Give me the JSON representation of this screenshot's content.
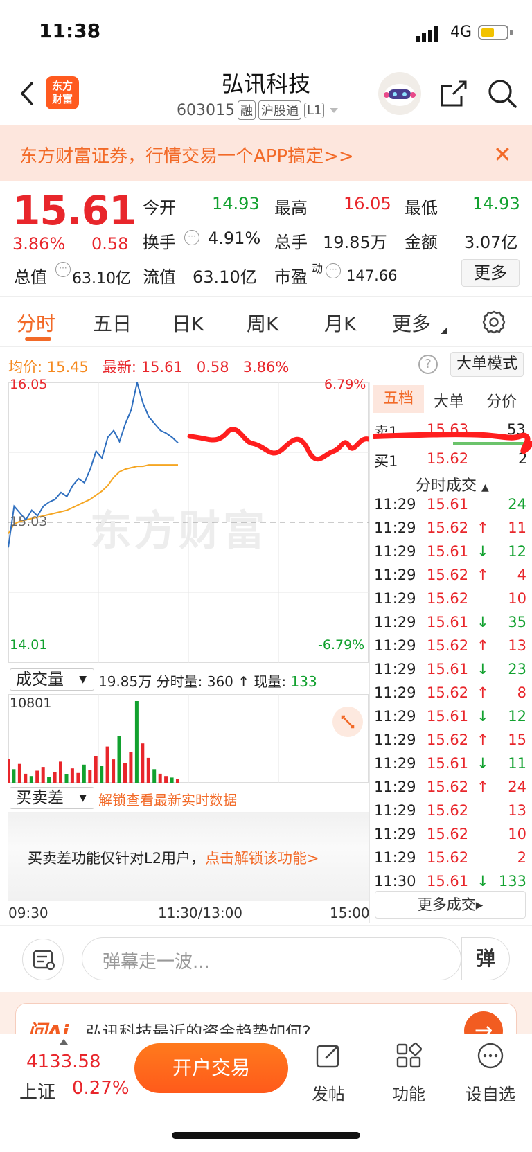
{
  "status_bar": {
    "time": "11:38",
    "network": "4G"
  },
  "header": {
    "app_logo_line1": "东方",
    "app_logo_line2": "财富",
    "stock_name": "弘讯科技",
    "stock_code": "603015",
    "tags": [
      "融",
      "沪股通",
      "L1"
    ]
  },
  "banner": {
    "text": "东方财富证券，行情交易一个APP搞定>>"
  },
  "quote": {
    "last_price": "15.61",
    "change_pct": "3.86%",
    "change_amt": "0.58",
    "fields": [
      {
        "label": "今开",
        "value": "14.93",
        "color": "#12a12f"
      },
      {
        "label": "最高",
        "value": "16.05",
        "color": "#e8262b"
      },
      {
        "label": "最低",
        "value": "14.93",
        "color": "#12a12f"
      },
      {
        "label": "换手",
        "value": "4.91%",
        "color": "#222222"
      },
      {
        "label": "总手",
        "value": "19.85万",
        "color": "#222222"
      },
      {
        "label": "金额",
        "value": "3.07亿",
        "color": "#222222"
      },
      {
        "label": "总值",
        "value": "63.10亿",
        "color": "#222222"
      },
      {
        "label": "流值",
        "value": "63.10亿",
        "color": "#222222"
      },
      {
        "label": "市盈",
        "sup": "动",
        "value": "147.66",
        "color": "#222222"
      }
    ],
    "more_label": "更多"
  },
  "tabs": [
    "分时",
    "五日",
    "日K",
    "周K",
    "月K",
    "更多"
  ],
  "avg_row": {
    "avg_label": "均价:",
    "avg_value": "15.45",
    "latest_label": "最新:",
    "latest_value": "15.61",
    "chg": "0.58",
    "pct": "3.86%",
    "big_order_label": "大单模式"
  },
  "chart_labels": {
    "y_top": "16.05",
    "y_bottom": "14.01",
    "pct_top": "6.79%",
    "pct_bottom": "-6.79%",
    "y_mid": "15.03",
    "watermark": "东方财富"
  },
  "volume": {
    "select_label": "成交量",
    "total": "19.85万",
    "period_label": "分时量:",
    "period_value": "360",
    "now_label": "现量:",
    "now_value": "133",
    "max_label": "10801"
  },
  "diff": {
    "select_label": "买卖差",
    "info": "解锁查看最新实时数据",
    "panel_text": "买卖差功能仅针对L2用户，",
    "panel_link": "点击解锁该功能>"
  },
  "time_axis": [
    "09:30",
    "11:30/13:00",
    "15:00"
  ],
  "right_panel": {
    "tabs": [
      "五档",
      "大单",
      "分价"
    ],
    "sell1": {
      "label": "卖1",
      "price": "15.63",
      "vol": "53"
    },
    "buy1": {
      "label": "买1",
      "price": "15.62",
      "vol": "2"
    },
    "trades_title": "分时成交",
    "trades": [
      {
        "time": "11:29",
        "price": "15.61",
        "dir": "",
        "vol": "24",
        "vcolor": "#12a12f"
      },
      {
        "time": "11:29",
        "price": "15.62",
        "dir": "↑",
        "vol": "11",
        "vcolor": "#e8262b"
      },
      {
        "time": "11:29",
        "price": "15.61",
        "dir": "↓",
        "vol": "12",
        "vcolor": "#12a12f"
      },
      {
        "time": "11:29",
        "price": "15.62",
        "dir": "↑",
        "vol": "4",
        "vcolor": "#e8262b"
      },
      {
        "time": "11:29",
        "price": "15.62",
        "dir": "",
        "vol": "10",
        "vcolor": "#e8262b"
      },
      {
        "time": "11:29",
        "price": "15.61",
        "dir": "↓",
        "vol": "35",
        "vcolor": "#12a12f"
      },
      {
        "time": "11:29",
        "price": "15.62",
        "dir": "↑",
        "vol": "13",
        "vcolor": "#e8262b"
      },
      {
        "time": "11:29",
        "price": "15.61",
        "dir": "↓",
        "vol": "23",
        "vcolor": "#12a12f"
      },
      {
        "time": "11:29",
        "price": "15.62",
        "dir": "↑",
        "vol": "8",
        "vcolor": "#e8262b"
      },
      {
        "time": "11:29",
        "price": "15.61",
        "dir": "↓",
        "vol": "12",
        "vcolor": "#12a12f"
      },
      {
        "time": "11:29",
        "price": "15.62",
        "dir": "↑",
        "vol": "15",
        "vcolor": "#e8262b"
      },
      {
        "time": "11:29",
        "price": "15.61",
        "dir": "↓",
        "vol": "11",
        "vcolor": "#12a12f"
      },
      {
        "time": "11:29",
        "price": "15.62",
        "dir": "↑",
        "vol": "24",
        "vcolor": "#e8262b"
      },
      {
        "time": "11:29",
        "price": "15.62",
        "dir": "",
        "vol": "13",
        "vcolor": "#e8262b"
      },
      {
        "time": "11:29",
        "price": "15.62",
        "dir": "",
        "vol": "10",
        "vcolor": "#e8262b"
      },
      {
        "time": "11:29",
        "price": "15.62",
        "dir": "",
        "vol": "2",
        "vcolor": "#e8262b"
      },
      {
        "time": "11:30",
        "price": "15.61",
        "dir": "↓",
        "vol": "133",
        "vcolor": "#12a12f"
      }
    ],
    "more_trades_label": "更多成交▸"
  },
  "danmu": {
    "placeholder": "弹幕走一波...",
    "button": "弹"
  },
  "ai": {
    "logo": "问Ai",
    "question": "弘讯科技最近的资金趋势如何?"
  },
  "bottom_bar": {
    "index_value": "4133.58",
    "index_name": "上证",
    "index_pct": "0.27%",
    "trade_button": "开户交易",
    "items": [
      "发帖",
      "功能",
      "设自选"
    ]
  },
  "colors": {
    "up": "#e8262b",
    "down": "#12a12f",
    "accent": "#f26a28",
    "price_line": "#2f6fbf",
    "avg_line": "#f5a623"
  },
  "chart_data": {
    "type": "line",
    "y_range": [
      14.01,
      16.05
    ],
    "prev_close": 15.03,
    "price_series": [
      14.85,
      15.15,
      15.1,
      15.05,
      15.12,
      15.08,
      15.15,
      15.18,
      15.2,
      15.25,
      15.22,
      15.3,
      15.35,
      15.32,
      15.42,
      15.55,
      15.5,
      15.65,
      15.7,
      15.62,
      15.75,
      15.85,
      16.05,
      15.9,
      15.8,
      15.75,
      15.7,
      15.68,
      15.65,
      15.61
    ],
    "avg_series": [
      14.95,
      15.02,
      15.04,
      15.05,
      15.06,
      15.07,
      15.08,
      15.09,
      15.1,
      15.11,
      15.12,
      15.14,
      15.16,
      15.18,
      15.2,
      15.23,
      15.26,
      15.3,
      15.36,
      15.4,
      15.42,
      15.43,
      15.44,
      15.44,
      15.45,
      15.45,
      15.45,
      15.45,
      15.45,
      15.45
    ],
    "volume_series": [
      3200,
      1800,
      2500,
      1200,
      900,
      1600,
      2100,
      800,
      1400,
      2800,
      1100,
      1900,
      1300,
      2400,
      1700,
      3500,
      2200,
      4800,
      3100,
      6200,
      2600,
      4100,
      10801,
      5200,
      3300,
      1800,
      1200,
      900,
      700,
      500
    ]
  }
}
